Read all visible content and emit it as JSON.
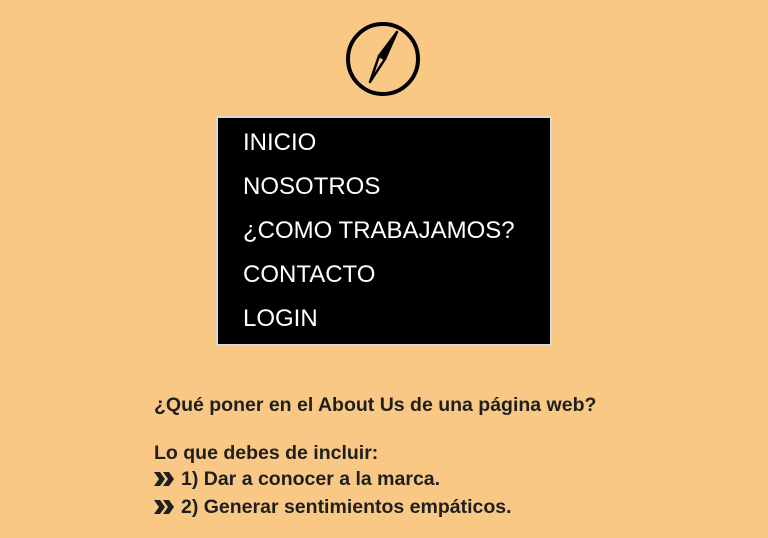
{
  "logo": {
    "icon": "compass-icon",
    "color": "#000000"
  },
  "nav": {
    "items": [
      {
        "label": "INICIO"
      },
      {
        "label": "NOSOTROS"
      },
      {
        "label": "¿COMO TRABAJAMOS?"
      },
      {
        "label": "CONTACTO"
      },
      {
        "label": "LOGIN"
      }
    ]
  },
  "content": {
    "question": "¿Qué poner en el About Us de una página web?",
    "list_title": "Lo que debes de incluir:",
    "list_icon": "double-chevron-right-icon",
    "items": [
      {
        "text": "1) Dar a conocer a la marca."
      },
      {
        "text": "2) Generar sentimientos empáticos."
      }
    ]
  },
  "colors": {
    "background": "#f8c884",
    "menu_background": "#000000",
    "menu_text": "#ffffff",
    "text": "#1f1f1f"
  }
}
